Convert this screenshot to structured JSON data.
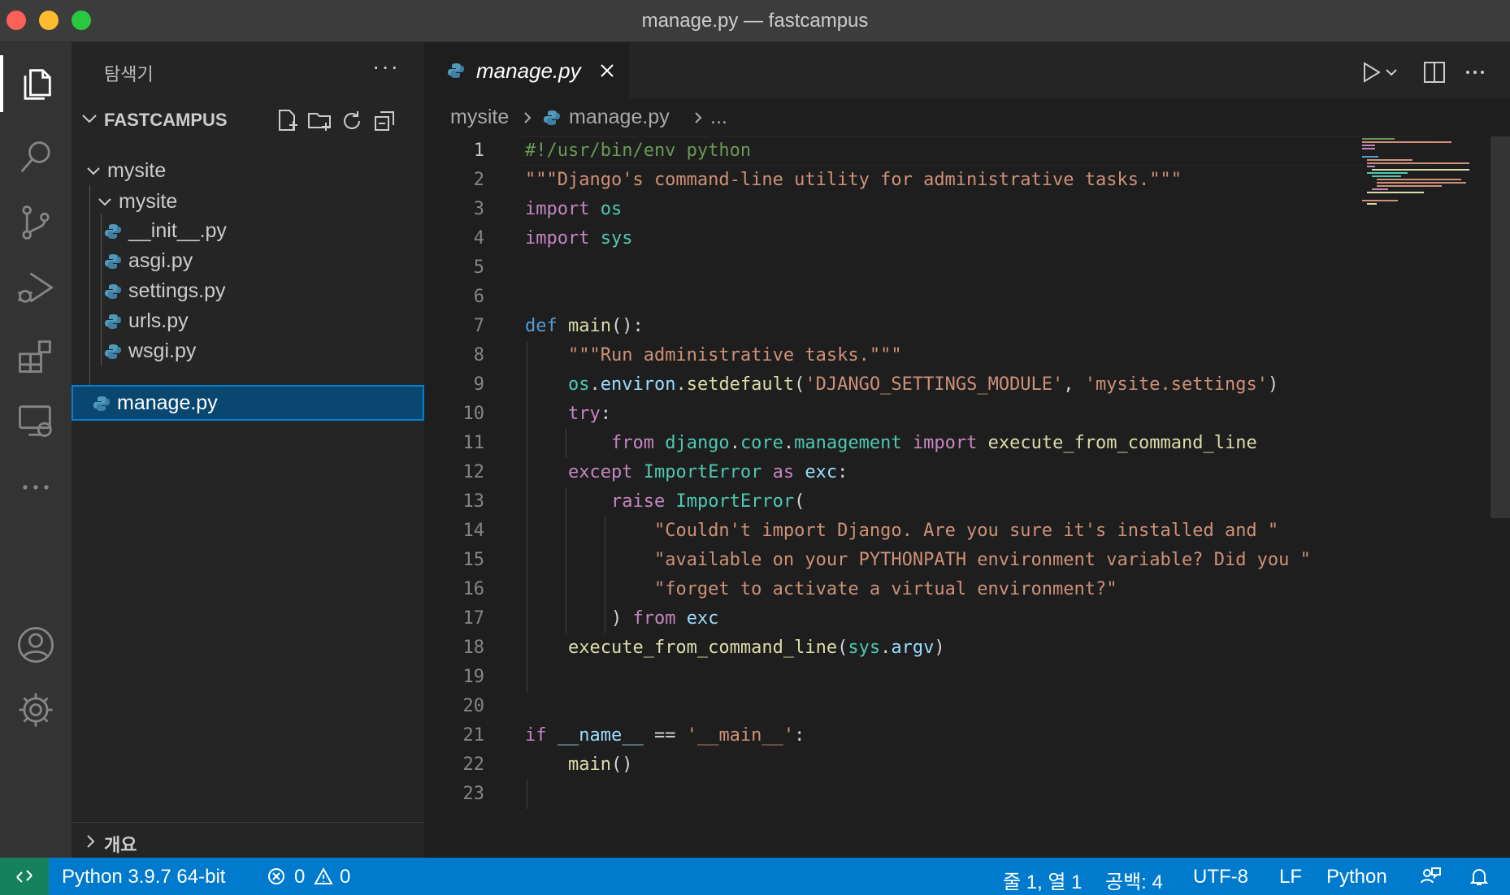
{
  "window": {
    "title": "manage.py — fastcampus"
  },
  "activity_bar": {
    "items": [
      "explorer-icon",
      "search-icon",
      "source-control-icon",
      "run-debug-icon",
      "extensions-icon",
      "remote-explorer-icon",
      "more-icon"
    ],
    "bottom": [
      "accounts-icon",
      "settings-gear-icon"
    ]
  },
  "sidebar": {
    "header": "탐색기",
    "more": "···",
    "section_title": "FASTCAMPUS",
    "tree": {
      "folder1": "mysite",
      "folder2": "mysite",
      "files": [
        "__init__.py",
        "asgi.py",
        "settings.py",
        "urls.py",
        "wsgi.py"
      ],
      "selected_file": "manage.py"
    },
    "outline_label": "개요"
  },
  "editor": {
    "tab_label": "manage.py",
    "breadcrumb": {
      "folder": "mysite",
      "file": "manage.py",
      "more": "..."
    },
    "line_numbers": [
      "1",
      "2",
      "3",
      "4",
      "5",
      "6",
      "7",
      "8",
      "9",
      "10",
      "11",
      "12",
      "13",
      "14",
      "15",
      "16",
      "17",
      "18",
      "19",
      "20",
      "21",
      "22",
      "23"
    ]
  },
  "statusbar": {
    "interpreter": "Python 3.9.7 64-bit",
    "errors": "0",
    "warnings": "0",
    "position": "줄 1, 열 1",
    "spaces": "공백: 4",
    "encoding": "UTF-8",
    "eol": "LF",
    "language": "Python"
  },
  "colors": {
    "accent": "#007acc",
    "selection": "#094771",
    "remote": "#16825d"
  }
}
